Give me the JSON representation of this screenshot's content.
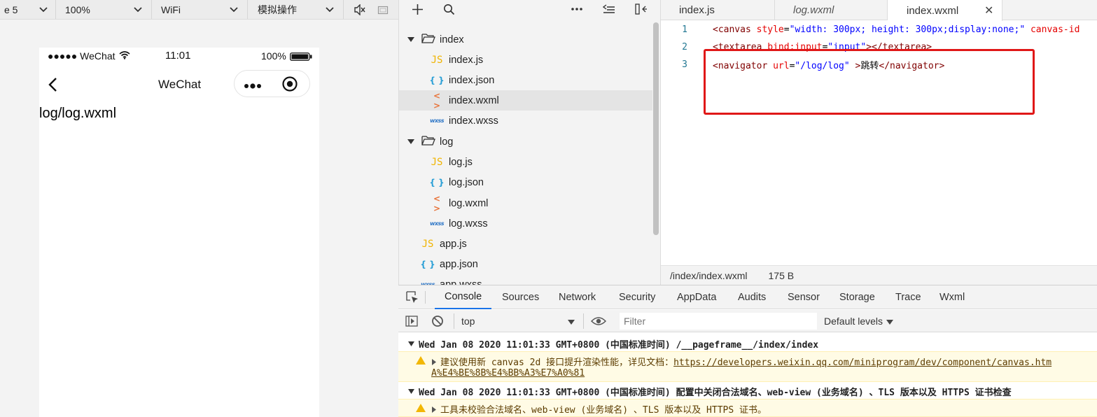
{
  "simulator": {
    "toolbar": {
      "device_value": "e 5",
      "zoom_value": "100%",
      "network_value": "WiFi",
      "ops_value": "模拟操作"
    },
    "status_bar": {
      "carrier": "●●●●● WeChat",
      "time": "11:01",
      "battery": "100%"
    },
    "nav_title": "WeChat",
    "page_text": "log/log.wxml"
  },
  "file_tree": {
    "folders": [
      {
        "name": "index",
        "files": [
          {
            "name": "index.js",
            "type": "js"
          },
          {
            "name": "index.json",
            "type": "json"
          },
          {
            "name": "index.wxml",
            "type": "wxml",
            "selected": true
          },
          {
            "name": "index.wxss",
            "type": "wxss"
          }
        ]
      },
      {
        "name": "log",
        "files": [
          {
            "name": "log.js",
            "type": "js"
          },
          {
            "name": "log.json",
            "type": "json"
          },
          {
            "name": "log.wxml",
            "type": "wxml"
          },
          {
            "name": "log.wxss",
            "type": "wxss"
          }
        ]
      }
    ],
    "root_files": [
      {
        "name": "app.js",
        "type": "js"
      },
      {
        "name": "app.json",
        "type": "json"
      },
      {
        "name": "app.wxss",
        "type": "wxss"
      }
    ],
    "icon_glyphs": {
      "js": "JS",
      "json": "{ }",
      "wxml": "< >",
      "wxss": "wxss"
    }
  },
  "editor": {
    "tabs": [
      {
        "label": "index.js"
      },
      {
        "label": "log.wxml"
      },
      {
        "label": "index.wxml",
        "active": true
      }
    ],
    "close_glyph": "✕",
    "lines": [
      {
        "num": "1",
        "text": "<canvas style=\"width: 300px; height: 300px;display:none;\" canvas-id"
      },
      {
        "num": "2",
        "text": "<textarea bind:input=\"input\"></textarea>"
      },
      {
        "num": "3",
        "text": "<navigator url=\"/log/log\" >跳转</navigator>"
      }
    ],
    "status": {
      "path": "/index/index.wxml",
      "size": "175 B"
    }
  },
  "devtools": {
    "tabs": [
      "Console",
      "Sources",
      "Network",
      "Security",
      "AppData",
      "Audits",
      "Sensor",
      "Storage",
      "Trace",
      "Wxml"
    ],
    "active_tab": "Console",
    "context": "top",
    "filter_placeholder": "Filter",
    "levels": "Default levels",
    "logs": [
      {
        "group": "Wed Jan 08 2020 11:01:33 GMT+0800 (中国标准时间) /__pageframe__/index/index",
        "warn_text": "建议使用新 canvas 2d 接口提升渲染性能，详见文档：",
        "warn_link": "https://developers.weixin.qq.com/miniprogram/dev/component/canvas.htm",
        "warn_link_cont": "A%E4%BE%8B%E4%BB%A3%E7%A0%81"
      },
      {
        "group": "Wed Jan 08 2020 11:01:33 GMT+0800 (中国标准时间) 配置中关闭合法域名、web-view (业务域名) 、TLS 版本以及 HTTPS 证书检查",
        "warn_text": "工具未校验合法域名、web-view (业务域名) 、TLS 版本以及 HTTPS 证书。"
      }
    ]
  },
  "colors": {
    "highlight": "#e01818",
    "active_tab_underline": "#1a73e8",
    "warning_bg": "#fffbe5"
  }
}
